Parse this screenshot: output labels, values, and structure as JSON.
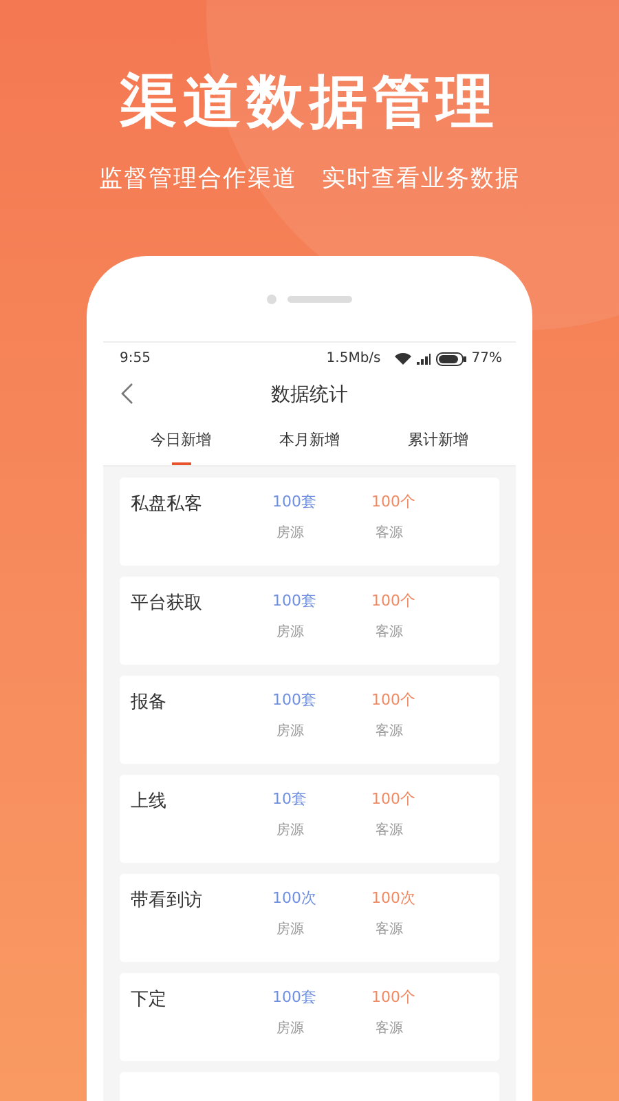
{
  "headline": "渠道数据管理",
  "subtitle": "监督管理合作渠道　实时查看业务数据",
  "status_bar": {
    "time": "9:55",
    "speed": "1.5Mb/s",
    "battery": "77%"
  },
  "header": {
    "title": "数据统计"
  },
  "tabs": [
    {
      "label": "今日新增",
      "selected": true
    },
    {
      "label": "本月新增",
      "selected": false
    },
    {
      "label": "累计新增",
      "selected": false
    }
  ],
  "cards": [
    {
      "name": "私盘私客",
      "stats": [
        {
          "value": "100套",
          "label": "房源",
          "color": "#6f8fe0"
        },
        {
          "value": "100个",
          "label": "客源",
          "color": "#ef8a62"
        }
      ]
    },
    {
      "name": "平台获取",
      "stats": [
        {
          "value": "100套",
          "label": "房源",
          "color": "#6f8fe0"
        },
        {
          "value": "100个",
          "label": "客源",
          "color": "#ef8a62"
        }
      ]
    },
    {
      "name": "报备",
      "stats": [
        {
          "value": "100套",
          "label": "房源",
          "color": "#6f8fe0"
        },
        {
          "value": "100个",
          "label": "客源",
          "color": "#ef8a62"
        }
      ]
    },
    {
      "name": "上线",
      "stats": [
        {
          "value": "10套",
          "label": "房源",
          "color": "#6f8fe0"
        },
        {
          "value": "100个",
          "label": "客源",
          "color": "#ef8a62"
        }
      ]
    },
    {
      "name": "带看到访",
      "stats": [
        {
          "value": "100次",
          "label": "房源",
          "color": "#6f8fe0"
        },
        {
          "value": "100次",
          "label": "客源",
          "color": "#ef8a62"
        }
      ]
    },
    {
      "name": "下定",
      "stats": [
        {
          "value": "100套",
          "label": "房源",
          "color": "#6f8fe0"
        },
        {
          "value": "100个",
          "label": "客源",
          "color": "#ef8a62"
        }
      ]
    }
  ]
}
